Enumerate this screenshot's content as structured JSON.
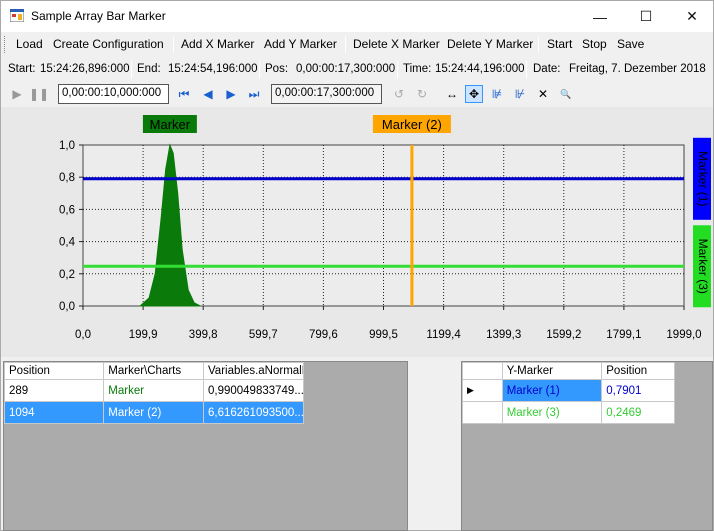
{
  "window": {
    "title": "Sample Array Bar Marker"
  },
  "controls": {
    "minimize": "—",
    "maximize": "☐",
    "close": "✕"
  },
  "menu": {
    "load": "Load",
    "create_config": "Create Configuration",
    "add_x": "Add X Marker",
    "add_y": "Add Y Marker",
    "delete_x": "Delete X Marker",
    "delete_y": "Delete Y Marker",
    "start": "Start",
    "stop": "Stop",
    "save": "Save"
  },
  "info": {
    "start_label": "Start:",
    "start_value": "15:24:26,896:000",
    "end_label": "End:",
    "end_value": "15:24:54,196:000",
    "pos_label": "Pos:",
    "pos_value": "0,00:00:17,300:000",
    "time_label": "Time:",
    "time_value": "15:24:44,196:000",
    "date_label": "Date:",
    "date_value": "Freitag, 7. Dezember 2018"
  },
  "toolbar": {
    "interval_value": "0,00:00:10,000:000",
    "position_value": "0,00:00:17,300:000"
  },
  "colors": {
    "marker1": "#0a7a0a",
    "marker2": "#ffa500",
    "ymarker1": "#0000cc",
    "ymarker3": "#33dd33",
    "selection": "#3399ff"
  },
  "chart_data": {
    "type": "area",
    "series": [
      {
        "name": "Variables.aNormalD",
        "x": [
          190,
          220,
          240,
          260,
          275,
          289,
          300,
          315,
          330,
          350,
          370,
          390
        ],
        "values": [
          0.0,
          0.05,
          0.2,
          0.55,
          0.85,
          1.0,
          0.95,
          0.7,
          0.35,
          0.1,
          0.02,
          0.0
        ]
      }
    ],
    "x_ticks": [
      "0,0",
      "199,9",
      "399,8",
      "599,7",
      "799,6",
      "999,5",
      "1199,4",
      "1399,3",
      "1599,2",
      "1799,1",
      "1999,0"
    ],
    "y_ticks": [
      "1,0",
      "0,8",
      "0,6",
      "0,4",
      "0,2",
      "0,0"
    ],
    "xlim": [
      0,
      1999.0
    ],
    "ylim": [
      0,
      1.0
    ],
    "grid": true,
    "x_markers": [
      {
        "label": "Marker",
        "x": 289
      },
      {
        "label": "Marker (2)",
        "x": 1094
      }
    ],
    "y_markers": [
      {
        "label": "Marker (1)",
        "y": 0.7901
      },
      {
        "label": "Marker (3)",
        "y": 0.2469
      }
    ]
  },
  "left_grid": {
    "headers": [
      "Position",
      "Marker\\Charts",
      "Variables.aNormalD"
    ],
    "rows": [
      [
        "289",
        "Marker",
        "0,990049833749..."
      ],
      [
        "1094",
        "Marker (2)",
        "6,616261093500..."
      ]
    ]
  },
  "right_grid": {
    "headers": [
      "Y-Marker",
      "Position"
    ],
    "rows": [
      [
        "Marker (1)",
        "0,7901"
      ],
      [
        "Marker (3)",
        "0,2469"
      ]
    ]
  }
}
